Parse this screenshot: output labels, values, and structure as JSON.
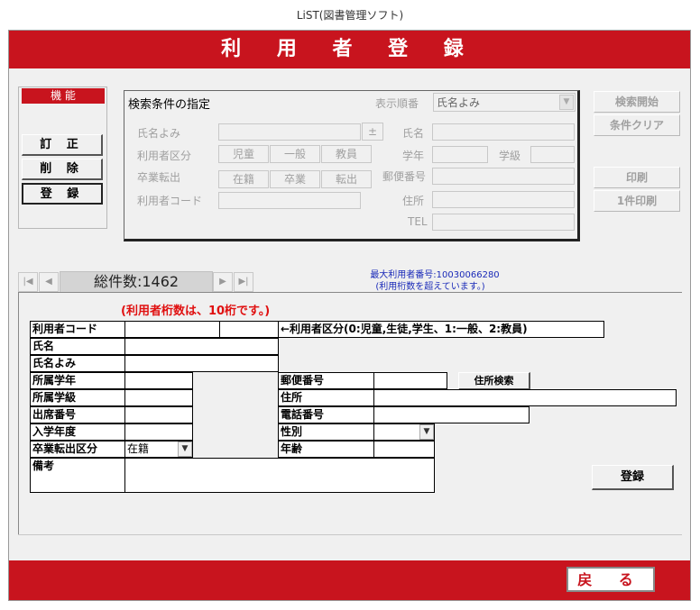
{
  "window": {
    "title": "LiST(図書管理ソフト)"
  },
  "header": {
    "title": "利 用 者 登 録"
  },
  "functions": {
    "title": "機 能",
    "edit": "訂 正",
    "delete": "削 除",
    "register": "登 録"
  },
  "search": {
    "title": "検索条件の指定",
    "sort_label": "表示順番",
    "sort_value": "氏名よみ",
    "name_kana_label": "氏名よみ",
    "plus": "±",
    "user_type_label": "利用者区分",
    "user_types": [
      "児童",
      "一般",
      "教員"
    ],
    "grad_label": "卒業転出",
    "grad_options": [
      "在籍",
      "卒業",
      "転出"
    ],
    "user_code_label": "利用者コード",
    "name_label": "氏名",
    "grade_label": "学年",
    "class_label": "学級",
    "postal_label": "郵便番号",
    "address_label": "住所",
    "tel_label": "TEL",
    "start_button": "検索開始",
    "clear_button": "条件クリア",
    "print_button": "印刷",
    "print_one_button": "1件印刷"
  },
  "nav": {
    "first": "|◀",
    "prev": "◀",
    "count_label": "総件数:1462",
    "next": "▶",
    "last": "▶|",
    "max_user": "最大利用者番号:10030066280",
    "max_user_note": "(利用桁数を超えています。)"
  },
  "form": {
    "digits_note": "(利用者桁数は、10桁です。)",
    "user_code": "利用者コード",
    "user_type_hint": "←利用者区分(0:児童,生徒,学生、1:一般、2:教員)",
    "name": "氏名",
    "name_kana": "氏名よみ",
    "grade": "所属学年",
    "class": "所属学級",
    "attendance_no": "出席番号",
    "entry_year": "入学年度",
    "grad_type": "卒業転出区分",
    "grad_value": "在籍",
    "notes": "備考",
    "postal": "郵便番号",
    "address_search": "住所検索",
    "address": "住所",
    "phone": "電話番号",
    "gender": "性別",
    "age": "年齢",
    "register_button": "登録"
  },
  "footer": {
    "back_button": "戻 る"
  }
}
